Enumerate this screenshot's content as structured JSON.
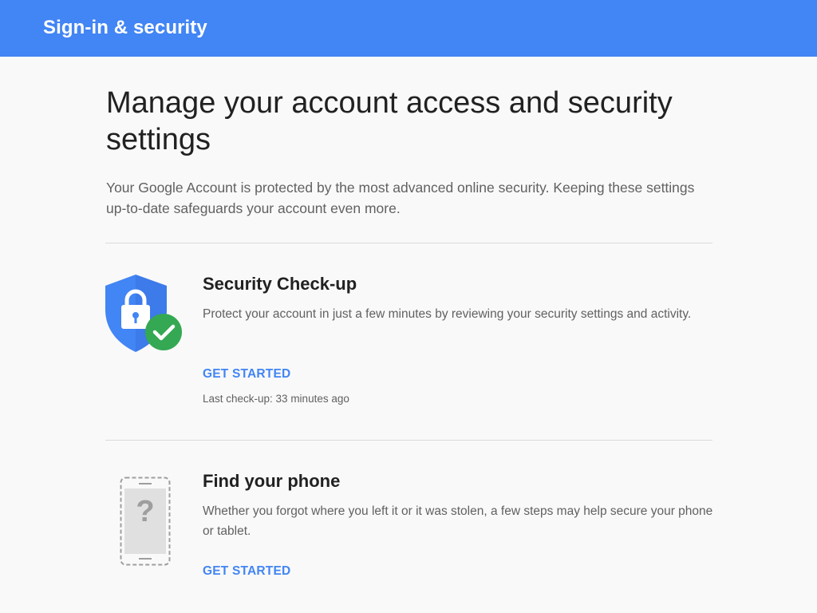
{
  "header": {
    "title": "Sign-in & security"
  },
  "main": {
    "title": "Manage your account access and security settings",
    "intro": "Your Google Account is protected by the most advanced online security. Keeping these settings up-to-date safeguards your account even more."
  },
  "cards": [
    {
      "icon": "shield-check-icon",
      "title": "Security Check-up",
      "description": "Protect your account in just a few minutes by reviewing your security settings and activity.",
      "action": "GET STARTED",
      "meta": "Last check-up: 33 minutes ago"
    },
    {
      "icon": "phone-question-icon",
      "title": "Find your phone",
      "description": "Whether you forgot where you left it or it was stolen, a few steps may help secure your phone or tablet.",
      "action": "GET STARTED"
    }
  ],
  "colors": {
    "header": "#4285f4",
    "link": "#4285f4",
    "shield": "#4285f4",
    "check": "#34a853"
  }
}
